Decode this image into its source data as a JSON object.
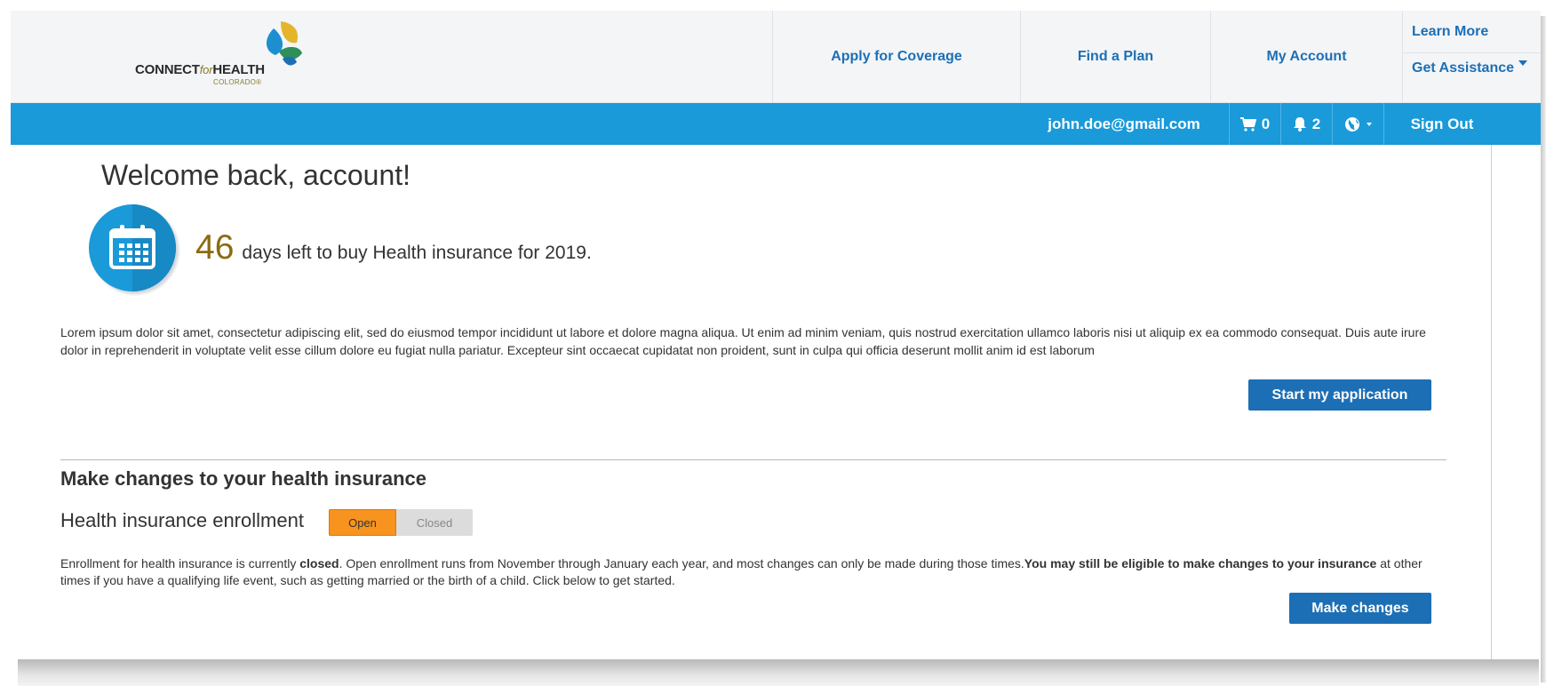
{
  "header": {
    "logo": {
      "main": "CONNECT",
      "for": "for",
      "health": "HEALTH",
      "sub": "COLORADO®"
    },
    "nav": [
      "Apply for Coverage",
      "Find a Plan",
      "My Account"
    ],
    "learn_more": "Learn More",
    "get_assistance": "Get Assistance"
  },
  "userbar": {
    "email": "john.doe@gmail.com",
    "cart_count": "0",
    "notifications_count": "2",
    "sign_out": "Sign Out"
  },
  "main": {
    "welcome": "Welcome back, account!",
    "days_left": "46",
    "days_text": "days left to buy Health insurance for 2019.",
    "lorem": "Lorem ipsum dolor sit amet, consectetur adipiscing elit, sed do eiusmod tempor incididunt ut labore et dolore magna aliqua. Ut enim ad minim veniam, quis nostrud exercitation ullamco laboris nisi ut aliquip ex ea commodo consequat. Duis aute irure dolor in reprehenderit in voluptate velit esse cillum dolore eu fugiat nulla pariatur. Excepteur sint occaecat cupidatat non proident, sunt in culpa qui officia deserunt mollit anim id est laborum",
    "start_button": "Start my application",
    "section_title": "Make changes to your health insurance",
    "enrollment_label": "Health insurance enrollment",
    "toggle_open": "Open",
    "toggle_closed": "Closed",
    "enroll_p1": "Enrollment for health insurance is currently ",
    "enroll_closed": "closed",
    "enroll_p2": ". Open enrollment runs from November through January each year, and most changes can only be made during those times.",
    "enroll_bold": "You may still be eligible to make changes to your insurance",
    "enroll_p3": " at other times if you have a qualifying life event, such as getting married or the birth of a child. Click below to get started.",
    "make_changes_button": "Make changes"
  },
  "colors": {
    "primary_blue": "#1d6fb5",
    "bar_blue": "#1a9ad9",
    "toggle_orange": "#f7931e"
  }
}
